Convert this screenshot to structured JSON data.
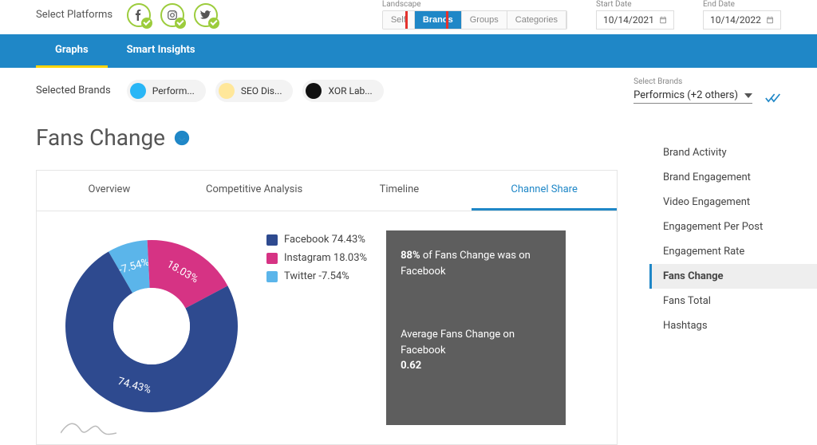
{
  "top": {
    "platforms_label": "Select Platforms",
    "landscape_label": "Landscape",
    "seg": {
      "self": "Self",
      "brands": "Brands",
      "groups": "Groups",
      "categories": "Categories"
    },
    "start_label": "Start Date",
    "end_label": "End Date",
    "start_value": "10/14/2021",
    "end_value": "10/14/2022"
  },
  "blue_tabs": {
    "graphs": "Graphs",
    "insights": "Smart Insights"
  },
  "selected": {
    "label": "Selected Brands",
    "chips": [
      {
        "label": "Perform...",
        "color": "#29b6f6"
      },
      {
        "label": "SEO Dis...",
        "color": "#ffe79a"
      },
      {
        "label": "XOR Lab...",
        "color": "#111111"
      }
    ],
    "right_label": "Select Brands",
    "right_value": "Performics (+2 others)"
  },
  "page_title": "Fans Change",
  "card_tabs": {
    "overview": "Overview",
    "comp": "Competitive Analysis",
    "timeline": "Timeline",
    "channel": "Channel Share"
  },
  "chart_data": {
    "type": "pie",
    "title": "Fans Change — Channel Share",
    "series": [
      {
        "name": "Facebook",
        "value": 74.43,
        "label": "74.43%",
        "color": "#2e4a8f"
      },
      {
        "name": "Instagram",
        "value": 18.03,
        "label": "18.03%",
        "color": "#d63384"
      },
      {
        "name": "Twitter",
        "value": -7.54,
        "label": "-7.54%",
        "abs": 7.54,
        "color": "#5bb5ea"
      }
    ],
    "legend": [
      "Facebook 74.43%",
      "Instagram 18.03%",
      "Twitter -7.54%"
    ]
  },
  "info": {
    "line1_pct": "88%",
    "line1_rest": " of Fans Change was on Facebook",
    "line2_a": "Average Fans Change on Facebook",
    "line2_b": "0.62"
  },
  "metrics": [
    "Brand Activity",
    "Brand Engagement",
    "Video Engagement",
    "Engagement Per Post",
    "Engagement Rate",
    "Fans Change",
    "Fans Total",
    "Hashtags"
  ],
  "metrics_active_index": 5
}
